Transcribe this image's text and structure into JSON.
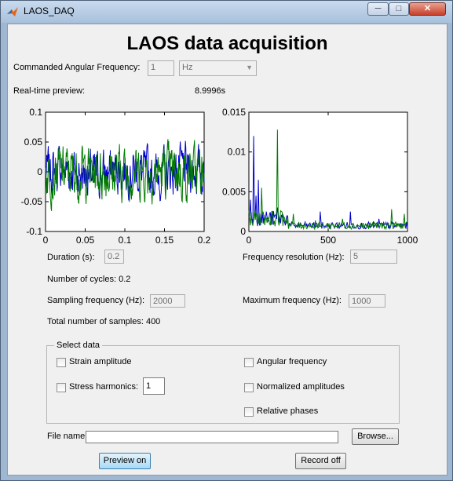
{
  "window": {
    "title": "LAOS_DAQ"
  },
  "heading": "LAOS data acquisition",
  "commanded_freq": {
    "label": "Commanded Angular Frequency:",
    "value": "1",
    "unit": "Hz"
  },
  "preview": {
    "label": "Real-time preview:",
    "time": "8.9996s"
  },
  "chart_data": [
    {
      "type": "line",
      "title": "",
      "xlabel": "",
      "ylabel": "",
      "xlim": [
        0,
        0.2
      ],
      "ylim": [
        -0.1,
        0.1
      ],
      "xticks": [
        "0",
        "0.05",
        "0.1",
        "0.15",
        "0.2"
      ],
      "yticks": [
        "0.1",
        "0.05",
        "0",
        "-0.05",
        "-0.1"
      ],
      "n_points": 400,
      "series": [
        {
          "color": "#0000cc",
          "values_note_amplitude": 0.035
        },
        {
          "color": "#007a00",
          "values_note_amplitude": 0.04
        }
      ],
      "grid": false
    },
    {
      "type": "line",
      "title": "",
      "xlabel": "",
      "ylabel": "",
      "xlim": [
        0,
        1000
      ],
      "ylim": [
        0,
        0.015
      ],
      "xticks": [
        "0",
        "500",
        "1000"
      ],
      "yticks": [
        "0.015",
        "0.01",
        "0.005",
        "0"
      ],
      "series": [
        {
          "color": "#0000cc",
          "peaks": [
            [
              10,
              0.004
            ],
            [
              30,
              0.012
            ],
            [
              45,
              0.0045
            ],
            [
              60,
              0.0065
            ],
            [
              110,
              0.0025
            ],
            [
              180,
              0.003
            ],
            [
              450,
              0.0025
            ],
            [
              640,
              0.0025
            ],
            [
              820,
              0.0016
            ]
          ]
        },
        {
          "color": "#007a00",
          "peaks": [
            [
              80,
              0.0055
            ],
            [
              180,
              0.0128
            ],
            [
              280,
              0.0022
            ],
            [
              420,
              0.0014
            ],
            [
              590,
              0.0016
            ],
            [
              900,
              0.0028
            ],
            [
              980,
              0.0022
            ]
          ]
        }
      ],
      "grid": false
    }
  ],
  "settings": {
    "duration_label": "Duration (s):",
    "duration_value": "0.2",
    "cycles_text": "Number of cycles: 0.2",
    "sampling_label": "Sampling frequency (Hz):",
    "sampling_value": "2000",
    "samples_text": "Total number of samples: 400",
    "resolution_label": "Frequency resolution (Hz):",
    "resolution_value": "5",
    "maxfreq_label": "Maximum frequency (Hz):",
    "maxfreq_value": "1000"
  },
  "select_data": {
    "title": "Select data",
    "strain": "Strain amplitude",
    "stress_harmonics": "Stress harmonics:",
    "stress_harmonics_value": "1",
    "angular": "Angular frequency",
    "normalized": "Normalized amplitudes",
    "phases": "Relative phases"
  },
  "file": {
    "label": "File name:",
    "value": "",
    "browse": "Browse..."
  },
  "buttons": {
    "preview": "Preview on",
    "record": "Record off"
  }
}
